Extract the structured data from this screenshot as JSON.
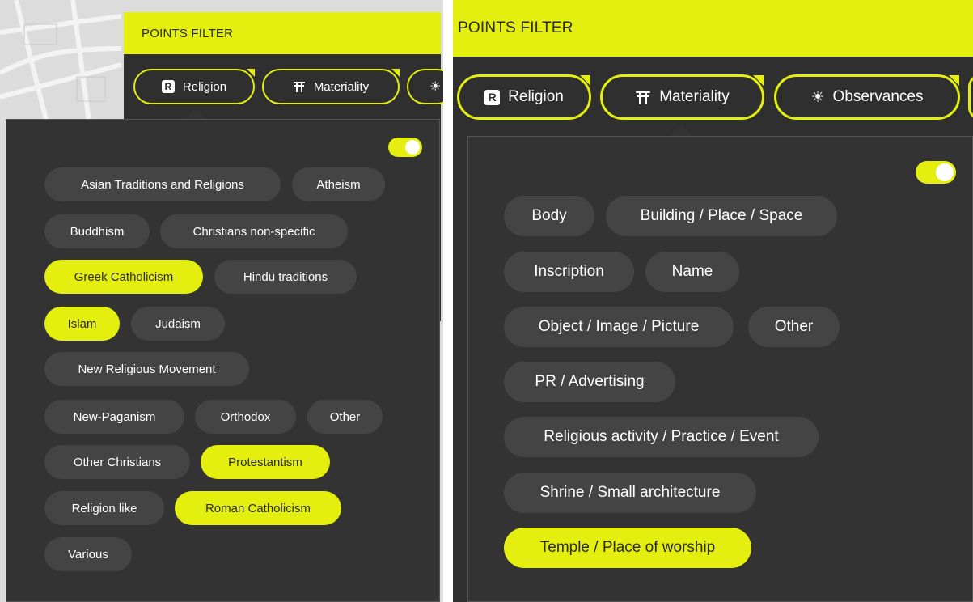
{
  "left": {
    "header_title": "POINTS FILTER",
    "tabs": [
      {
        "label": "Religion",
        "icon": "religion-r-icon"
      },
      {
        "label": "Materiality",
        "icon": "torii-icon"
      }
    ],
    "chips": [
      {
        "label": "Asian Traditions and Religions",
        "selected": false
      },
      {
        "label": "Atheism",
        "selected": false
      },
      {
        "label": "Buddhism",
        "selected": false
      },
      {
        "label": "Christians non-specific",
        "selected": false
      },
      {
        "label": "Greek Catholicism",
        "selected": true
      },
      {
        "label": "Hindu traditions",
        "selected": false
      },
      {
        "label": "Islam",
        "selected": true
      },
      {
        "label": "Judaism",
        "selected": false
      },
      {
        "label": "New Religious Movement",
        "selected": false
      },
      {
        "label": "New-Paganism",
        "selected": false
      },
      {
        "label": "Orthodox",
        "selected": false
      },
      {
        "label": "Other",
        "selected": false
      },
      {
        "label": "Other Christians",
        "selected": false
      },
      {
        "label": "Protestantism",
        "selected": true
      },
      {
        "label": "Religion like",
        "selected": false
      },
      {
        "label": "Roman Catholicism",
        "selected": true
      },
      {
        "label": "Various",
        "selected": false
      }
    ],
    "toggle_on": true
  },
  "right": {
    "header_title": "POINTS FILTER",
    "tabs": [
      {
        "label": "Religion",
        "icon": "religion-r-icon"
      },
      {
        "label": "Materiality",
        "icon": "torii-icon"
      },
      {
        "label": "Observances",
        "icon": "sun-icon"
      }
    ],
    "chips": [
      {
        "label": "Body",
        "selected": false
      },
      {
        "label": "Building / Place / Space",
        "selected": false
      },
      {
        "label": "Inscription",
        "selected": false
      },
      {
        "label": "Name",
        "selected": false
      },
      {
        "label": "Object / Image / Picture",
        "selected": false
      },
      {
        "label": "Other",
        "selected": false
      },
      {
        "label": "PR / Advertising",
        "selected": false
      },
      {
        "label": "Religious activity / Practice / Event",
        "selected": false
      },
      {
        "label": "Shrine / Small architecture",
        "selected": false
      },
      {
        "label": "Temple / Place of worship",
        "selected": true
      }
    ],
    "toggle_on": true
  },
  "colors": {
    "accent": "#e4ef10",
    "panel": "#333333",
    "chip": "#444444"
  }
}
